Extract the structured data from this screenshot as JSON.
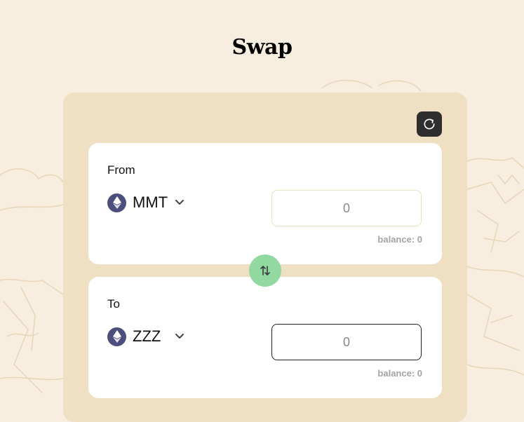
{
  "page": {
    "title": "Swap"
  },
  "from": {
    "label": "From",
    "token": "MMT",
    "amount_placeholder": "0",
    "balance": "balance: 0"
  },
  "to": {
    "label": "To",
    "token": "ZZZ",
    "amount_placeholder": "0",
    "balance": "balance: 0"
  },
  "icons": {
    "refresh": "refresh-icon",
    "token": "ethereum-icon",
    "dropdown": "chevron-down-icon",
    "switch": "swap-arrows-icon"
  },
  "colors": {
    "background": "#f8eee0",
    "panel": "#efdfc3",
    "card": "#ffffff",
    "switch_button": "#91d9a0",
    "refresh_button": "#2e2e2e",
    "token_icon": "#4a4f7c"
  }
}
